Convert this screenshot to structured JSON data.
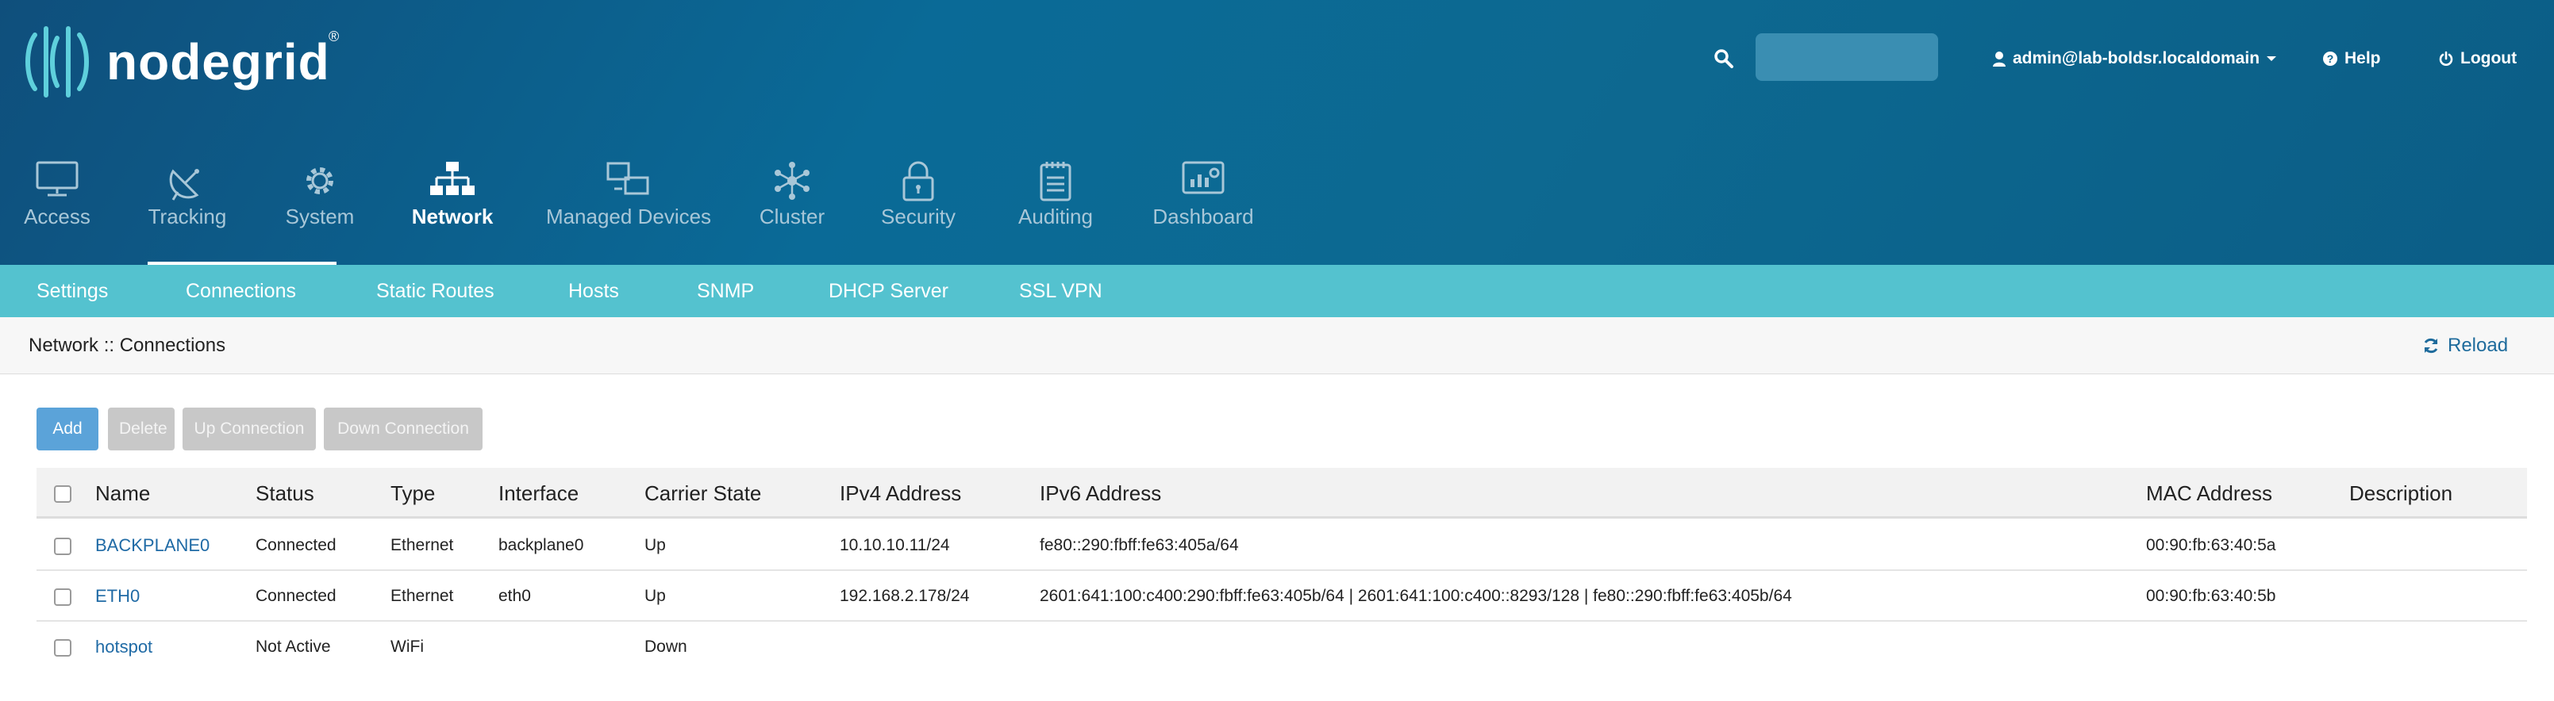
{
  "app": {
    "brand": "nodegrid",
    "registered_mark": "®"
  },
  "header": {
    "search": {
      "placeholder": ""
    },
    "user": "admin@lab-boldsr.localdomain",
    "help_label": "Help",
    "logout_label": "Logout"
  },
  "main_nav": [
    {
      "label": "Access",
      "icon": "monitor-icon"
    },
    {
      "label": "Tracking",
      "icon": "satellite-dish-icon"
    },
    {
      "label": "System",
      "icon": "gear-icon"
    },
    {
      "label": "Network",
      "icon": "network-tree-icon",
      "active": true
    },
    {
      "label": "Managed Devices",
      "icon": "devices-icon"
    },
    {
      "label": "Cluster",
      "icon": "cluster-icon"
    },
    {
      "label": "Security",
      "icon": "lock-icon"
    },
    {
      "label": "Auditing",
      "icon": "notepad-icon"
    },
    {
      "label": "Dashboard",
      "icon": "dashboard-icon"
    }
  ],
  "sub_nav": [
    {
      "label": "Settings"
    },
    {
      "label": "Connections",
      "active": true
    },
    {
      "label": "Static Routes"
    },
    {
      "label": "Hosts"
    },
    {
      "label": "SNMP"
    },
    {
      "label": "DHCP Server"
    },
    {
      "label": "SSL VPN"
    }
  ],
  "breadcrumb": "Network :: Connections",
  "reload_label": "Reload",
  "toolbar": {
    "add": "Add",
    "delete": "Delete",
    "up_connection": "Up Connection",
    "down_connection": "Down Connection"
  },
  "table": {
    "columns": [
      "Name",
      "Status",
      "Type",
      "Interface",
      "Carrier State",
      "IPv4 Address",
      "IPv6 Address",
      "MAC Address",
      "Description"
    ],
    "rows": [
      {
        "name": "BACKPLANE0",
        "status": "Connected",
        "type": "Ethernet",
        "interface": "backplane0",
        "carrier_state": "Up",
        "ipv4": "10.10.10.11/24",
        "ipv6": "fe80::290:fbff:fe63:405a/64",
        "mac": "00:90:fb:63:40:5a",
        "description": ""
      },
      {
        "name": "ETH0",
        "status": "Connected",
        "type": "Ethernet",
        "interface": "eth0",
        "carrier_state": "Up",
        "ipv4": "192.168.2.178/24",
        "ipv6": "2601:641:100:c400:290:fbff:fe63:405b/64 | 2601:641:100:c400::8293/128 | fe80::290:fbff:fe63:405b/64",
        "mac": "00:90:fb:63:40:5b",
        "description": ""
      },
      {
        "name": "hotspot",
        "status": "Not Active",
        "type": "WiFi",
        "interface": "",
        "carrier_state": "Down",
        "ipv4": "",
        "ipv6": "",
        "mac": "",
        "description": ""
      }
    ]
  },
  "colors": {
    "header_bg": "#0b6590",
    "subnav_bg": "#54c2cf",
    "link": "#1f6aa5",
    "primary_button": "#5ba3d9",
    "disabled_button": "#c8c8c8"
  }
}
